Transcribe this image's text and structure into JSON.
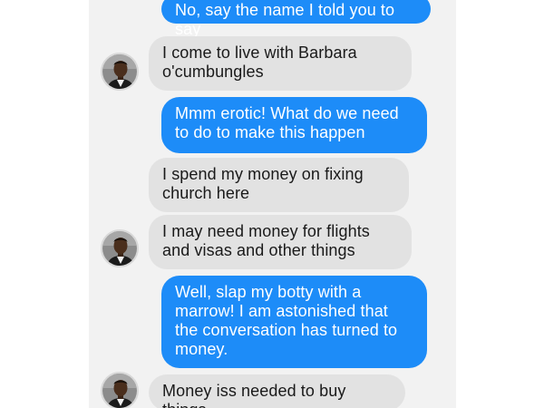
{
  "messages": [
    {
      "direction": "outgoing",
      "text": "No, say the name I told you to say"
    },
    {
      "direction": "incoming",
      "text": "I come to live with Barbara o'cumbungles"
    },
    {
      "direction": "outgoing",
      "text": "Mmm erotic! What do we need to do to make this happen"
    },
    {
      "direction": "incoming",
      "text": "I spend my money on fixing church here"
    },
    {
      "direction": "incoming",
      "text": "I may need money for flights and visas and other things"
    },
    {
      "direction": "outgoing",
      "text": "Well, slap my botty with a marrow! I am astonished that the conversation has turned to money."
    },
    {
      "direction": "incoming",
      "text": "Money iss needed to buy things"
    }
  ],
  "colors": {
    "outgoing_bubble": "#1d8cf8",
    "incoming_bubble": "#e2e2e2",
    "thread_background": "#f2f2f2"
  },
  "icons": {
    "avatar": "contact-avatar-icon"
  }
}
